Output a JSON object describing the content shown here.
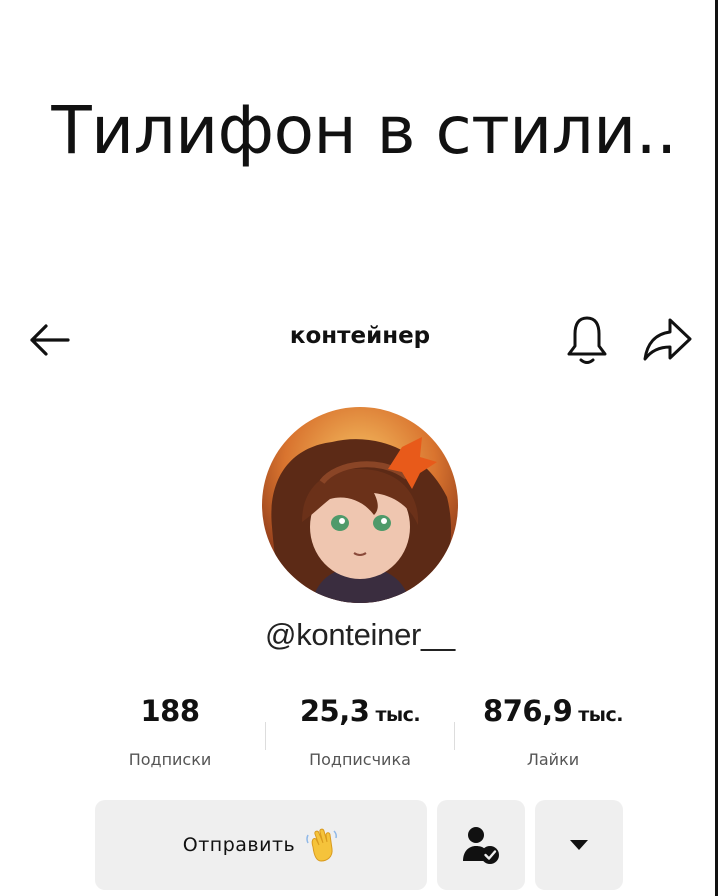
{
  "caption": "Тилифон в стили..",
  "header": {
    "title": "контейнер",
    "back_icon": "arrow-left-icon",
    "bell_icon": "bell-icon",
    "share_icon": "share-icon"
  },
  "profile": {
    "handle": "@konteiner__",
    "avatar_desc": "avatar"
  },
  "stats": [
    {
      "value": "188",
      "unit": "",
      "label": "Подписки"
    },
    {
      "value": "25,3",
      "unit": "тыс.",
      "label": "Подписчика"
    },
    {
      "value": "876,9",
      "unit": "тыс.",
      "label": "Лайки"
    }
  ],
  "actions": {
    "send_label": "Отправить",
    "wave_icon": "waving-hand-icon",
    "friend_icon": "user-check-icon",
    "more_icon": "triangle-down-icon"
  },
  "colors": {
    "button_bg": "#efefef",
    "text": "#111111",
    "muted": "#555555"
  }
}
